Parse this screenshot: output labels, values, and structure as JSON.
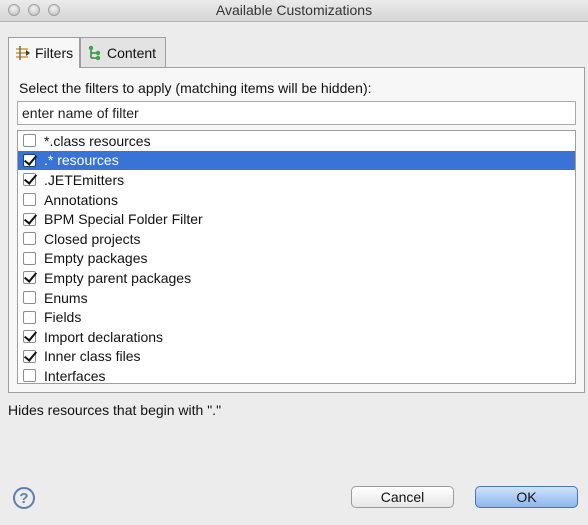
{
  "window": {
    "title": "Available Customizations"
  },
  "tabs": [
    {
      "label": "Filters",
      "active": true,
      "icon": "filter-icon"
    },
    {
      "label": "Content",
      "active": false,
      "icon": "content-tree-icon"
    }
  ],
  "filters_panel": {
    "prompt": "Select the filters to apply (matching items will be hidden):",
    "search_placeholder": "enter name of filter",
    "items": [
      {
        "label": "*.class resources",
        "checked": false,
        "selected": false
      },
      {
        "label": ".* resources",
        "checked": true,
        "selected": true
      },
      {
        "label": ".JETEmitters",
        "checked": true,
        "selected": false
      },
      {
        "label": "Annotations",
        "checked": false,
        "selected": false
      },
      {
        "label": "BPM Special Folder Filter",
        "checked": true,
        "selected": false
      },
      {
        "label": "Closed projects",
        "checked": false,
        "selected": false
      },
      {
        "label": "Empty packages",
        "checked": false,
        "selected": false
      },
      {
        "label": "Empty parent packages",
        "checked": true,
        "selected": false
      },
      {
        "label": "Enums",
        "checked": false,
        "selected": false
      },
      {
        "label": "Fields",
        "checked": false,
        "selected": false
      },
      {
        "label": "Import declarations",
        "checked": true,
        "selected": false
      },
      {
        "label": "Inner class files",
        "checked": true,
        "selected": false
      },
      {
        "label": "Interfaces",
        "checked": false,
        "selected": false
      }
    ]
  },
  "description": "Hides resources that begin with \".\"",
  "buttons": {
    "help": "?",
    "cancel": "Cancel",
    "ok": "OK"
  },
  "colors": {
    "selection": "#3a73d6",
    "ok_button": "#8db6ee"
  }
}
